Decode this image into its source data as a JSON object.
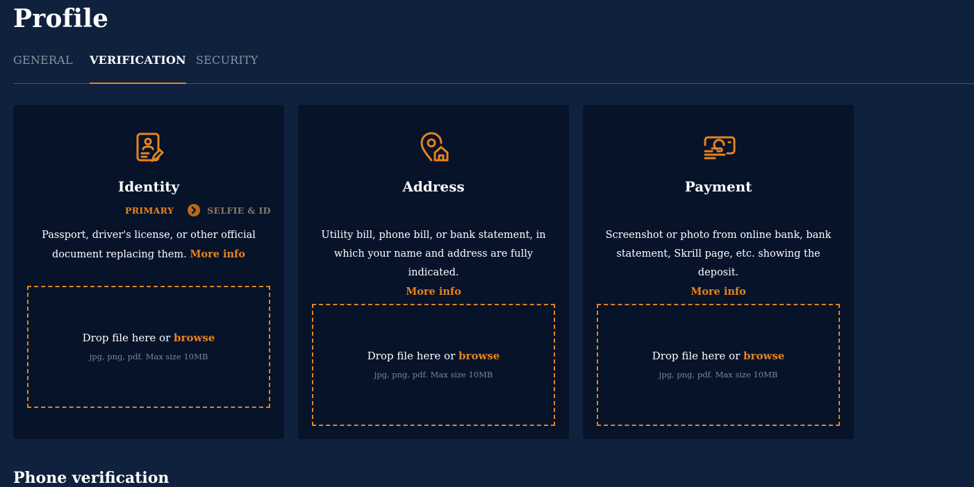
{
  "page": {
    "title": "Profile"
  },
  "tabs": [
    {
      "label": "GENERAL",
      "active": false
    },
    {
      "label": "VERIFICATION",
      "active": true
    },
    {
      "label": "SECURITY",
      "active": false
    }
  ],
  "colors": {
    "background": "#0f213d",
    "card_background": "#061329",
    "accent": "#e8821f",
    "muted_text": "#8a94a3"
  },
  "cards": {
    "identity": {
      "icon": "id-document-icon",
      "title": "Identity",
      "steps": {
        "primary": "PRIMARY",
        "secondary": "SELFIE & ID"
      },
      "description_1": "Passport, driver's license, or other official",
      "description_2": "document replacing them.",
      "more_info": "More info",
      "dropzone": {
        "text": "Drop file here or",
        "browse": "browse",
        "hint": "jpg, png, pdf. Max size 10MB"
      }
    },
    "address": {
      "icon": "location-home-icon",
      "title": "Address",
      "description_1": "Utility bill, phone bill, or bank statement, in",
      "description_2": "which your name and address are fully indicated.",
      "more_info": "More info",
      "dropzone": {
        "text": "Drop file here or",
        "browse": "browse",
        "hint": "jpg, png, pdf. Max size 10MB"
      }
    },
    "payment": {
      "icon": "payment-card-icon",
      "title": "Payment",
      "description_1": "Screenshot or photo from online bank, bank",
      "description_2": "statement, Skrill page, etc. showing the deposit.",
      "more_info": "More info",
      "dropzone": {
        "text": "Drop file here or",
        "browse": "browse",
        "hint": "jpg, png, pdf. Max size 10MB"
      }
    }
  },
  "phone_section": {
    "title": "Phone verification"
  }
}
